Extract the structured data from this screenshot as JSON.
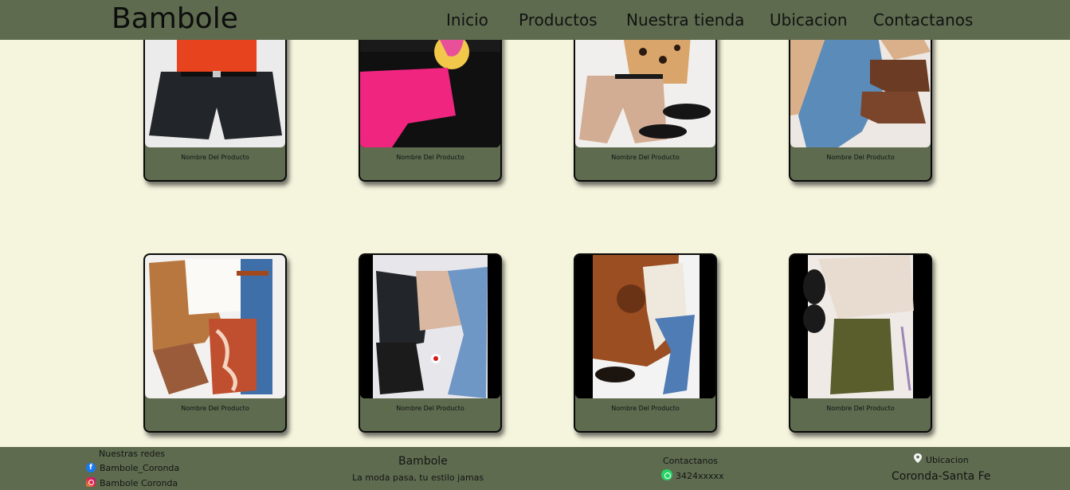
{
  "header": {
    "brand": "Bambole",
    "nav": [
      "Inicio",
      "Productos",
      "Nuestra tienda",
      "Ubicacion",
      "Contactanos"
    ]
  },
  "products": [
    {
      "name": "Nombre Del Producto",
      "image": "outfit-black-shorts"
    },
    {
      "name": "Nombre Del Producto",
      "image": "outfit-pink-shorts"
    },
    {
      "name": "Nombre Del Producto",
      "image": "outfit-beige-shorts"
    },
    {
      "name": "Nombre Del Producto",
      "image": "outfit-blue-jeans-boots"
    },
    {
      "name": "Nombre Del Producto",
      "image": "outfit-puffer-jacket"
    },
    {
      "name": "Nombre Del Producto",
      "image": "outfit-leather-jacket"
    },
    {
      "name": "Nombre Del Producto",
      "image": "outfit-brown-sweater"
    },
    {
      "name": "Nombre Del Producto",
      "image": "outfit-olive-skirt"
    }
  ],
  "footer": {
    "social_title": "Nuestras redes",
    "facebook": "Bambole_Coronda",
    "instagram": "Bambole Coronda",
    "brand": "Bambole",
    "tagline": "La moda pasa, tu estilo jamas",
    "contact_title": "Contactanos",
    "phone": "3424xxxxx",
    "location_title": "Ubicacion",
    "location": "Coronda-Santa Fe"
  },
  "colors": {
    "background": "#f5f5de",
    "header": "#5e6b4f",
    "card": "#5e6b4f"
  }
}
